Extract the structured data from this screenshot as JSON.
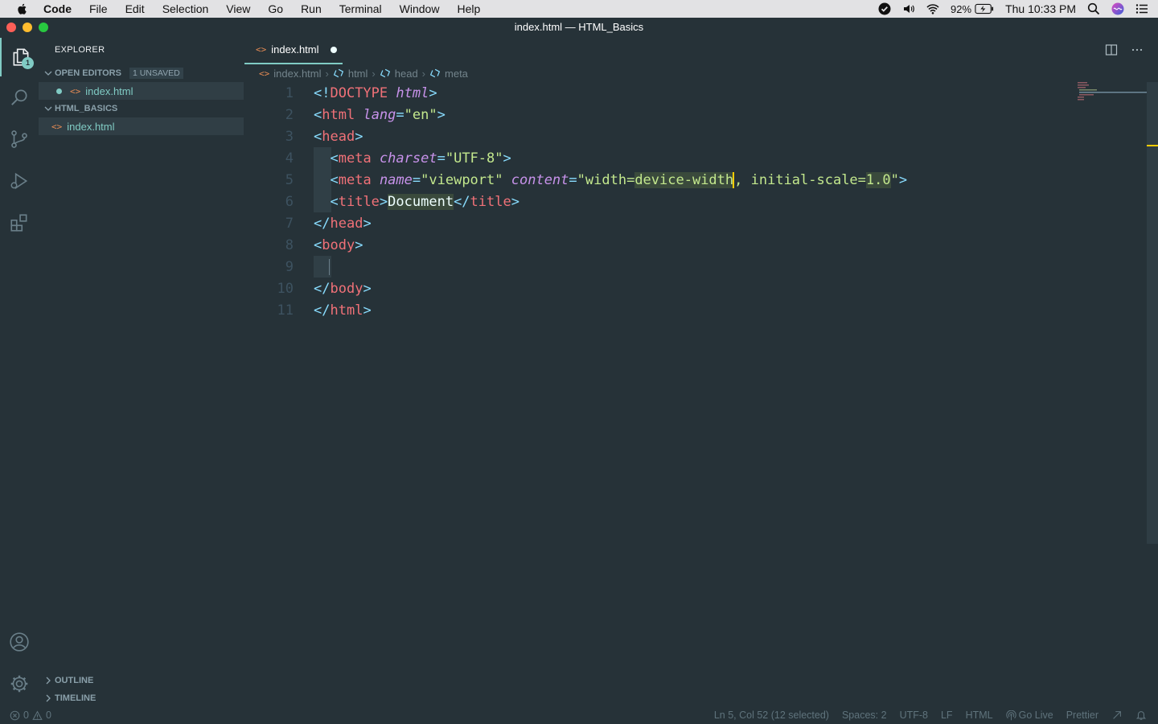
{
  "menubar": {
    "app": "Code",
    "items": [
      "File",
      "Edit",
      "Selection",
      "View",
      "Go",
      "Run",
      "Terminal",
      "Window",
      "Help"
    ],
    "battery": "92%",
    "clock": "Thu 10:33 PM"
  },
  "window": {
    "title": "index.html — HTML_Basics"
  },
  "activity": {
    "explorer_badge": "1"
  },
  "sidebar": {
    "title": "EXPLORER",
    "open_editors": {
      "label": "OPEN EDITORS",
      "badge": "1 UNSAVED",
      "file": "index.html"
    },
    "folder": {
      "label": "HTML_BASICS",
      "file": "index.html"
    },
    "outline": "OUTLINE",
    "timeline": "TIMELINE"
  },
  "tab": {
    "label": "index.html"
  },
  "breadcrumb": {
    "file": "index.html",
    "c1": "html",
    "c2": "head",
    "c3": "meta"
  },
  "editor": {
    "line_numbers": [
      "1",
      "2",
      "3",
      "4",
      "5",
      "6",
      "7",
      "8",
      "9",
      "10",
      "11"
    ],
    "l1": {
      "open": "<!",
      "doctype": "DOCTYPE",
      "sp": " ",
      "html": "html",
      "close": ">"
    },
    "l2": {
      "lt": "<",
      "tag": "html",
      "sp": " ",
      "attr": "lang",
      "eq": "=",
      "val": "\"en\"",
      "gt": ">"
    },
    "l3": {
      "lt": "<",
      "tag": "head",
      "gt": ">"
    },
    "l4": {
      "lt": "<",
      "tag": "meta",
      "sp": " ",
      "attr": "charset",
      "eq": "=",
      "val": "\"UTF-8\"",
      "gt": ">"
    },
    "l5": {
      "lt": "<",
      "tag": "meta",
      "sp1": " ",
      "attr1": "name",
      "eq1": "=",
      "val1": "\"viewport\"",
      "sp2": " ",
      "attr2": "content",
      "eq2": "=",
      "val2a": "\"width=",
      "val2sel": "device-width",
      "val2b": ", initial-scale=",
      "val2num": "1.0",
      "val2c": "\"",
      "gt": ">"
    },
    "l6": {
      "lt": "<",
      "tag": "title",
      "gt": ">",
      "text": "Document",
      "lt2": "</",
      "tag2": "title",
      "gt2": ">"
    },
    "l7": {
      "lt": "</",
      "tag": "head",
      "gt": ">"
    },
    "l8": {
      "lt": "<",
      "tag": "body",
      "gt": ">"
    },
    "l10": {
      "lt": "</",
      "tag": "body",
      "gt": ">"
    },
    "l11": {
      "lt": "</",
      "tag": "html",
      "gt": ">"
    }
  },
  "status": {
    "errors": "0",
    "warnings": "0",
    "position": "Ln 5, Col 52 (12 selected)",
    "spaces": "Spaces: 2",
    "encoding": "UTF-8",
    "eol": "LF",
    "language": "HTML",
    "golive": "Go Live",
    "prettier": "Prettier"
  },
  "colors": {
    "background": "#263238",
    "accent": "#80cbc4",
    "tag": "#f07178",
    "attribute": "#c792ea",
    "string": "#c3e88d",
    "bracket": "#89ddff",
    "cursor": "#ffcc00"
  }
}
